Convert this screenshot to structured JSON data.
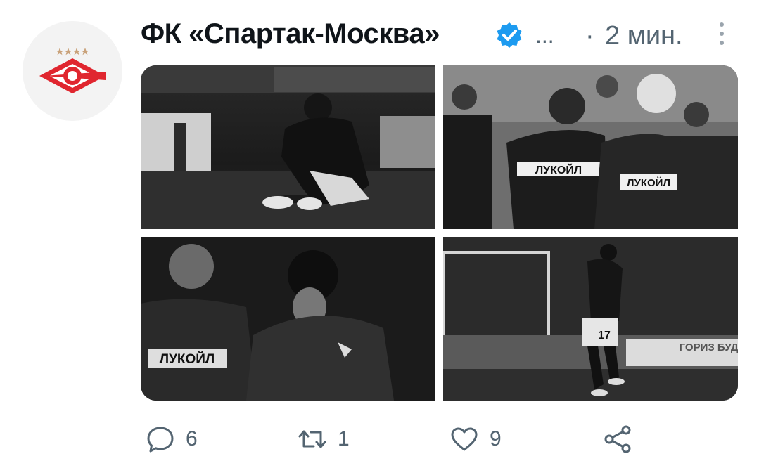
{
  "tweet": {
    "author_name": "ФК «Спартак-Москва»",
    "verified": true,
    "ellipsis": "...",
    "separator": "·",
    "time": "2 мин.",
    "photos": [
      {
        "alt_name": "player-sitting-on-pitch-photo"
      },
      {
        "alt_name": "players-walking-photo",
        "shirt_text": "ЛУКОЙЛ"
      },
      {
        "alt_name": "player-hand-on-face-photo",
        "shirt_text": "ЛУКОЙЛ"
      },
      {
        "alt_name": "player-number-17-photo",
        "shirt_number": "17",
        "board_text": "ГОРИЗ БУДУЩ"
      }
    ],
    "actions": {
      "reply_count": "6",
      "retweet_count": "1",
      "like_count": "9"
    }
  },
  "icons": {
    "avatar": "spartak-logo-icon",
    "verified": "verified-badge-icon",
    "more": "more-vertical-icon",
    "reply": "reply-icon",
    "retweet": "retweet-icon",
    "like": "heart-icon",
    "share": "share-icon"
  },
  "colors": {
    "accent": "#1d9bf0",
    "text": "#0f1419",
    "muted": "#536471",
    "spartak_red": "#e0262f"
  }
}
